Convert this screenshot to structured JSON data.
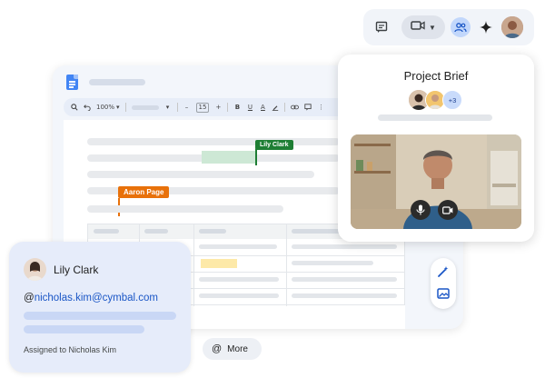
{
  "meet_toolbar": {
    "icons": [
      "chat-icon",
      "video-camera-icon",
      "chevron-down-icon",
      "people-icon",
      "gemini-sparkle-icon",
      "user-avatar"
    ]
  },
  "meet_card": {
    "title": "Project Brief",
    "participants_extra": "+3",
    "controls": [
      "microphone-icon",
      "camera-icon"
    ]
  },
  "doc": {
    "toolbar": {
      "zoom": "100%",
      "font_size": "15",
      "minus": "–",
      "plus": "+",
      "bold": "B",
      "underline": "U",
      "italic_a": "A"
    },
    "collaborators": [
      {
        "name": "Lily Clark",
        "color": "#1e7e34"
      },
      {
        "name": "Aaron Page",
        "color": "#e8710a"
      }
    ]
  },
  "profile_card": {
    "name": "Lily Clark",
    "email_at": "@",
    "email": "nicholas.kim@cymbal.com",
    "assigned": "Assigned to Nicholas Kim"
  },
  "more_button": {
    "icon": "@",
    "label": "More"
  },
  "colors": {
    "accent_blue": "#1a56c6",
    "highlight_green": "#cde8d5",
    "highlight_yellow": "#fde9a8"
  }
}
